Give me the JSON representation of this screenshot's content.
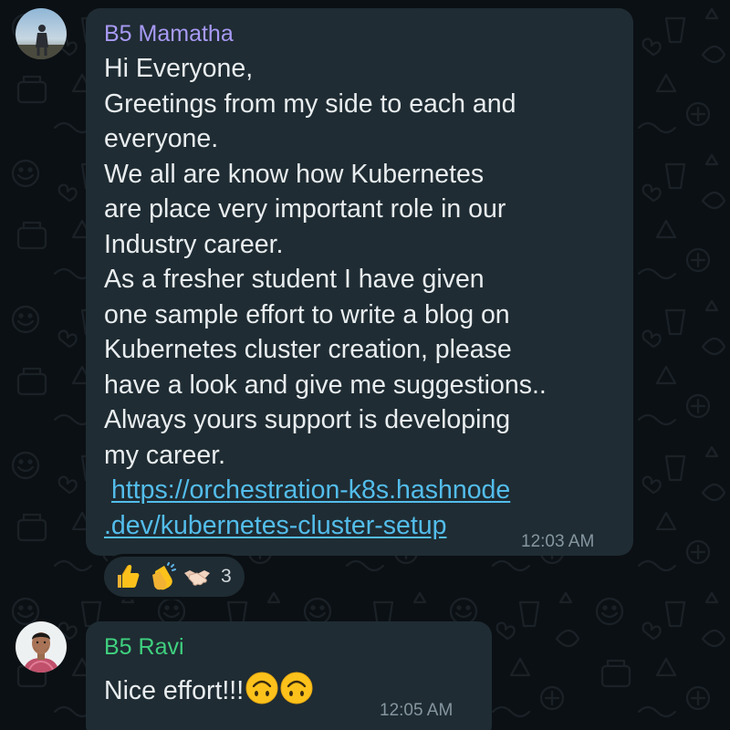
{
  "messages": [
    {
      "sender": "B5 Mamatha",
      "sender_color": "#a89af5",
      "text_lines": [
        "Hi Everyone,",
        "Greetings from my side to each and",
        "everyone.",
        "We all are know how Kubernetes",
        "are place very important role in our",
        "Industry career.",
        "As a fresher student I have given",
        "one sample effort to write a blog on",
        "Kubernetes cluster creation, please",
        "have a look and give me suggestions..",
        "Always yours support is developing",
        "my career."
      ],
      "link_lines": [
        "https://orchestration-k8s.hashnode",
        ".dev/kubernetes-cluster-setup"
      ],
      "time": "12:03 AM",
      "reactions": {
        "emojis": [
          "thumbs-up",
          "clapping-hands",
          "handshake"
        ],
        "count": "3"
      }
    },
    {
      "sender": "B5 Ravi",
      "sender_color": "#3fd07f",
      "text": "Nice effort!!!",
      "emojis": [
        "upside-down-face",
        "upside-down-face"
      ],
      "time": "12:05 AM"
    }
  ],
  "colors": {
    "bubble": "#1f2c33",
    "background": "#0b1014",
    "text": "#e9edef",
    "link": "#53bdeb",
    "timestamp": "#8696a0"
  }
}
